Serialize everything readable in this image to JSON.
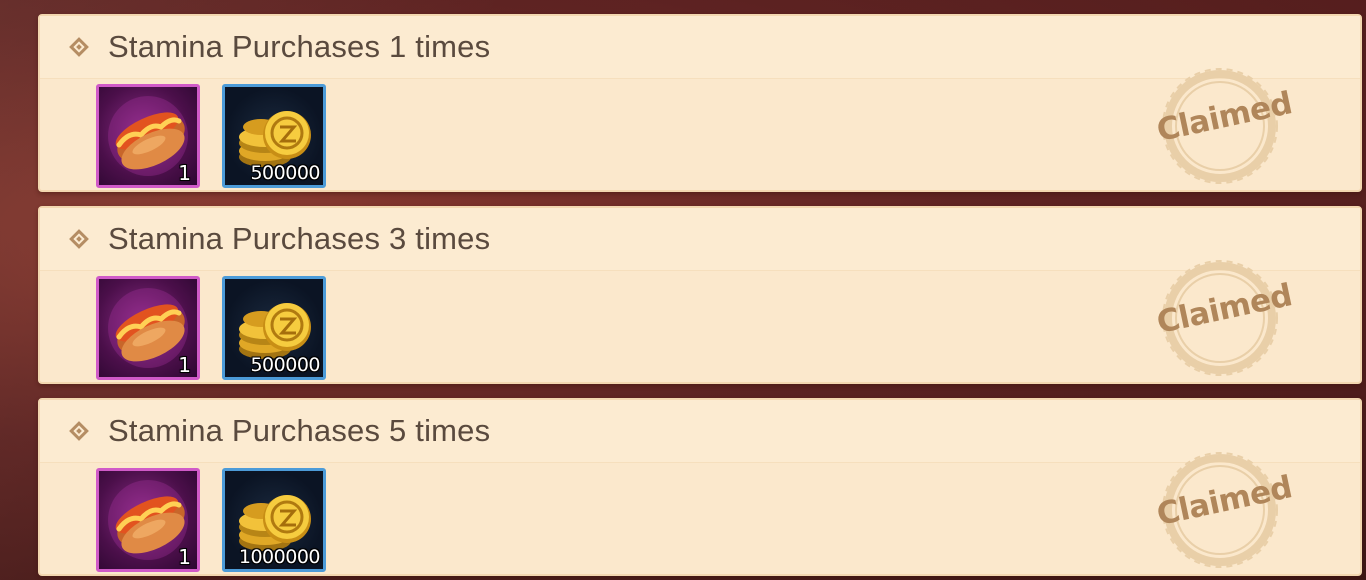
{
  "tasks": [
    {
      "title": "Stamina Purchases 1 times",
      "rewards": [
        {
          "icon": "hotdog-icon",
          "qty": "1"
        },
        {
          "icon": "gold-coins-icon",
          "qty": "500000"
        }
      ],
      "status": "Claimed"
    },
    {
      "title": "Stamina Purchases 3 times",
      "rewards": [
        {
          "icon": "hotdog-icon",
          "qty": "1"
        },
        {
          "icon": "gold-coins-icon",
          "qty": "500000"
        }
      ],
      "status": "Claimed"
    },
    {
      "title": "Stamina Purchases 5 times",
      "rewards": [
        {
          "icon": "hotdog-icon",
          "qty": "1"
        },
        {
          "icon": "gold-coins-icon",
          "qty": "1000000"
        }
      ],
      "status": "Claimed"
    }
  ],
  "colors": {
    "card_bg": "#fbe8cc",
    "title_text": "#5a4a3e",
    "stamp": "#b0865a",
    "epic_border": "#d05ac8",
    "rare_border": "#4c9bd8"
  }
}
